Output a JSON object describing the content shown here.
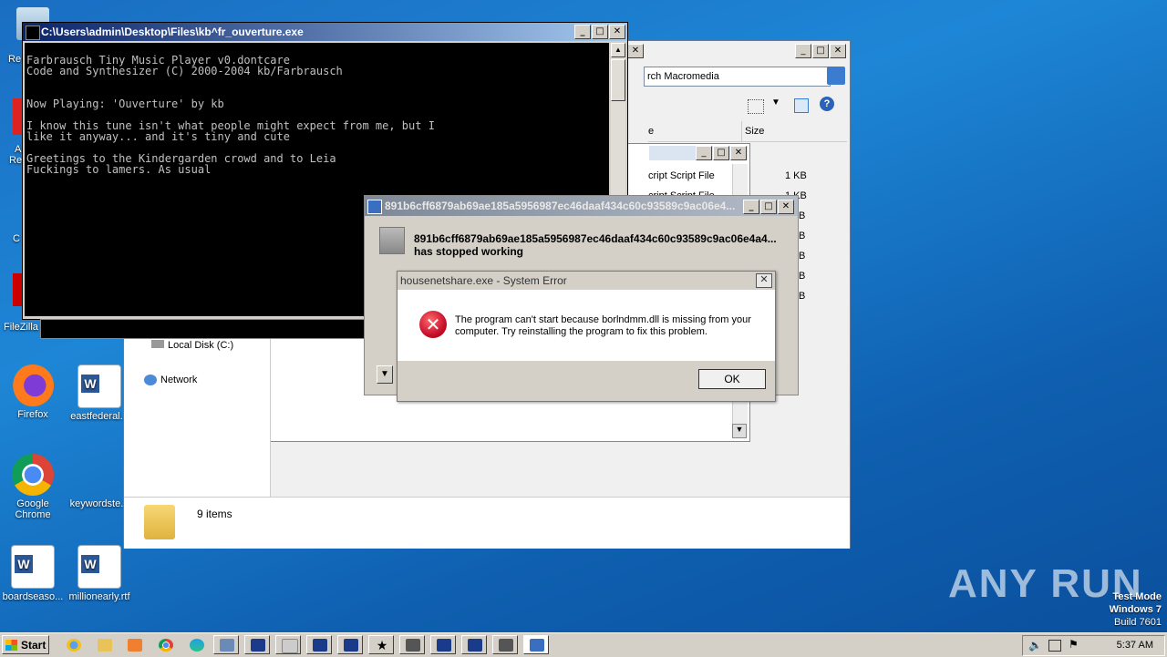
{
  "desktop": {
    "icons": [
      {
        "label": "Re",
        "top": 0
      },
      {
        "label": "Firefox"
      },
      {
        "label": "eastfederal..."
      },
      {
        "label": "Google Chrome"
      },
      {
        "label": "keywordste..."
      },
      {
        "label": "boardseaso..."
      },
      {
        "label": "millionearly.rtf"
      },
      {
        "label": "FileZilla C"
      }
    ],
    "partial_labels": [
      "Re",
      "A",
      "Re",
      "C"
    ]
  },
  "explorer": {
    "search_text": "rch Macromedia",
    "columns": [
      "e",
      "Size"
    ],
    "file_rows": [
      {
        "name": "cript Script File",
        "size": "1 KB"
      },
      {
        "name": "cript Script File",
        "size": "1 KB"
      },
      {
        "name": "",
        "size": "B"
      },
      {
        "name": "",
        "size": "B"
      },
      {
        "name": "",
        "size": "B"
      },
      {
        "name": "",
        "size": "B"
      },
      {
        "name": "",
        "size": "B"
      }
    ],
    "nav_items": [
      "Local Disk (C:)",
      "Network"
    ],
    "status": "9 items"
  },
  "console": {
    "title": "C:\\Users\\admin\\Desktop\\Files\\kb^fr_ouverture.exe",
    "lines": "Farbrausch Tiny Music Player v0.dontcare\nCode and Synthesizer (C) 2000-2004 kb/Farbrausch\n\n\nNow Playing: 'Ouverture' by kb\n\nI know this tune isn't what people might expect from me, but I\nlike it anyway... and it's tiny and cute\n\nGreetings to the Kindergarden crowd and to Leia\nFuckings to lamers. As usual"
  },
  "crash_dialog": {
    "title": "891b6cff6879ab69ae185a5956987ec46daaf434c60c93589c9ac06e4...",
    "message_line1": "891b6cff6879ab69ae185a5956987ec46daaf434c60c93589c9ac06e4a4...",
    "message_line2": "has stopped working"
  },
  "system_error": {
    "title": "housenetshare.exe - System Error",
    "close": "✕",
    "message": "The program can't start because borlndmm.dll is missing from your computer. Try reinstalling the program to fix this problem.",
    "ok_label": "OK"
  },
  "taskbar": {
    "start_label": "Start",
    "clock": "5:37 AM"
  },
  "watermark": "ANY RUN",
  "test_mode": {
    "line1": "Test Mode",
    "line2": "Windows 7",
    "line3": "Build 7601"
  }
}
